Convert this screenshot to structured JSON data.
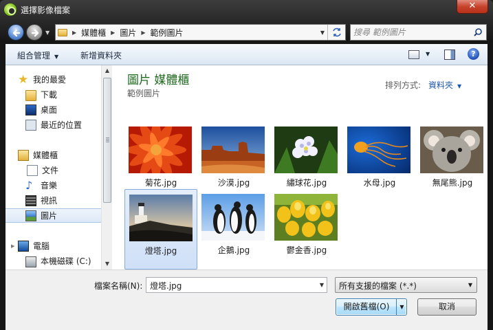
{
  "window": {
    "title": "選擇影像檔案"
  },
  "address": {
    "breadcrumbs": [
      "媒體櫃",
      "圖片",
      "範例圖片"
    ]
  },
  "search": {
    "placeholder": "搜尋 範例圖片"
  },
  "toolbar": {
    "organize": "組合管理",
    "new_folder": "新增資料夾"
  },
  "sidebar": {
    "favorites": {
      "label": "我的最愛",
      "items": [
        "下載",
        "桌面",
        "最近的位置"
      ]
    },
    "libraries": {
      "label": "媒體櫃",
      "items": [
        "文件",
        "音樂",
        "視訊",
        "圖片"
      ],
      "selected": "圖片"
    },
    "computer": {
      "label": "電腦",
      "items": [
        "本機磁碟 (C:)"
      ]
    }
  },
  "content": {
    "title": "圖片 媒體櫃",
    "subtitle": "範例圖片",
    "arrange_label": "排列方式:",
    "arrange_value": "資料夾",
    "files": [
      {
        "name": "菊花.jpg",
        "selected": false
      },
      {
        "name": "沙漠.jpg",
        "selected": false
      },
      {
        "name": "繡球花.jpg",
        "selected": false
      },
      {
        "name": "水母.jpg",
        "selected": false
      },
      {
        "name": "無尾熊.jpg",
        "selected": false
      },
      {
        "name": "燈塔.jpg",
        "selected": true
      },
      {
        "name": "企鵝.jpg",
        "selected": false
      },
      {
        "name": "鬱金香.jpg",
        "selected": false
      }
    ]
  },
  "footer": {
    "filename_label": "檔案名稱(N):",
    "filename_value": "燈塔.jpg",
    "filetype_value": "所有支援的檔案 (*.*)",
    "open_button": "開啟舊檔(O)",
    "cancel_button": "取消"
  },
  "icons": {
    "app": "app-icon",
    "back": "back-arrow-icon",
    "forward": "forward-arrow-icon",
    "refresh": "refresh-icon",
    "search": "search-icon",
    "help": "help-icon"
  },
  "colors": {
    "library_title": "#1e6b1e",
    "link": "#1e56b0",
    "selection": "#cfe0f7"
  }
}
